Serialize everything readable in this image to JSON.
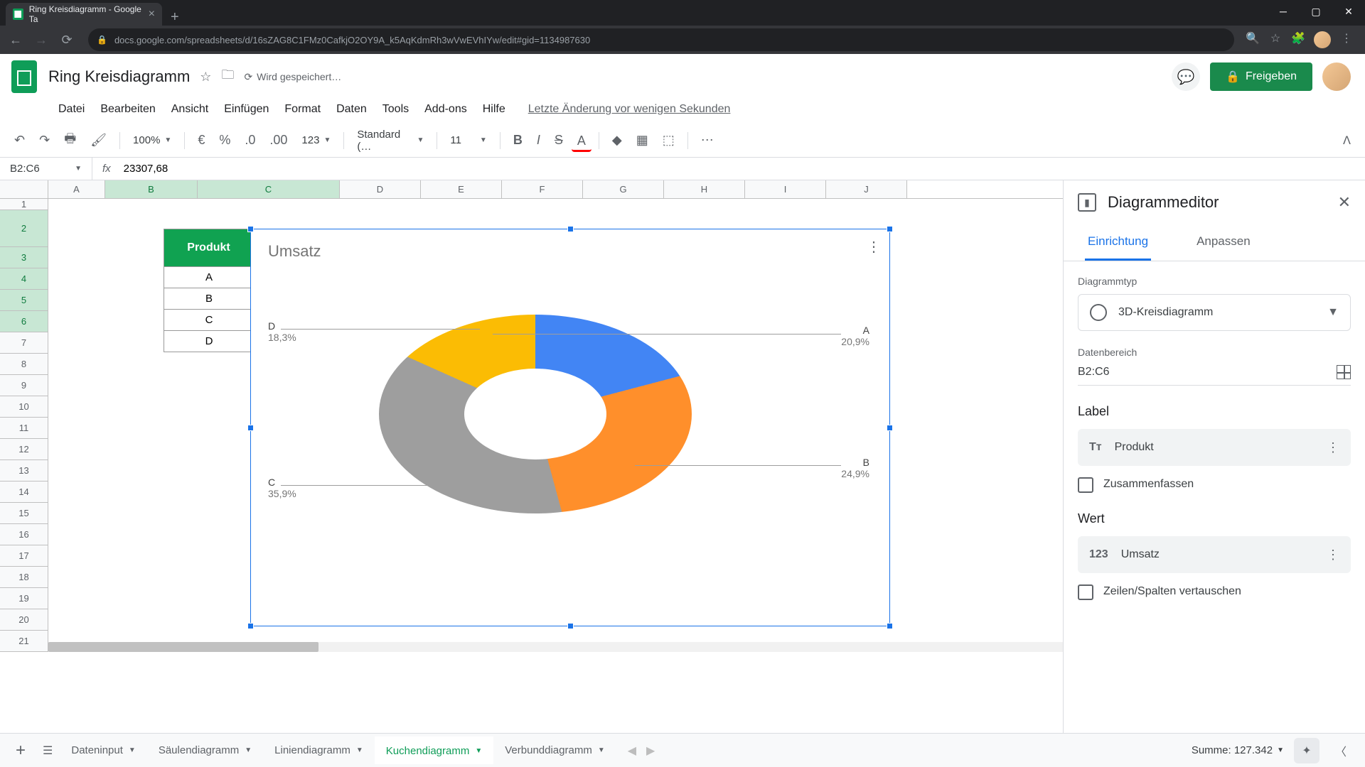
{
  "browser": {
    "tab_title": "Ring Kreisdiagramm - Google Ta",
    "url": "docs.google.com/spreadsheets/d/16sZAG8C1FMz0CafkjO2OY9A_k5AqKdmRh3wVwEVhIYw/edit#gid=1134987630"
  },
  "doc": {
    "title": "Ring Kreisdiagramm",
    "saving": "Wird gespeichert…",
    "last_edit": "Letzte Änderung vor wenigen Sekunden"
  },
  "menu": [
    "Datei",
    "Bearbeiten",
    "Ansicht",
    "Einfügen",
    "Format",
    "Daten",
    "Tools",
    "Add-ons",
    "Hilfe"
  ],
  "toolbar": {
    "zoom": "100%",
    "font": "Standard (…",
    "font_size": "11"
  },
  "share_label": "Freigeben",
  "formula_bar": {
    "cell_ref": "B2:C6",
    "value": "23307,68"
  },
  "columns": [
    "A",
    "B",
    "C",
    "D",
    "E",
    "F",
    "G",
    "H",
    "I",
    "J"
  ],
  "rows": [
    1,
    2,
    3,
    4,
    5,
    6,
    7,
    8,
    9,
    10,
    11,
    12,
    13,
    14,
    15,
    16,
    17,
    18,
    19,
    20,
    21
  ],
  "table": {
    "header": "Produkt",
    "rows": [
      "A",
      "B",
      "C",
      "D"
    ]
  },
  "chart": {
    "title": "Umsatz",
    "labels": {
      "A": {
        "name": "A",
        "pct": "20,9%"
      },
      "B": {
        "name": "B",
        "pct": "24,9%"
      },
      "C": {
        "name": "C",
        "pct": "35,9%"
      },
      "D": {
        "name": "D",
        "pct": "18,3%"
      }
    }
  },
  "chart_data": {
    "type": "pie",
    "title": "Umsatz",
    "categories": [
      "A",
      "B",
      "C",
      "D"
    ],
    "values": [
      20.9,
      24.9,
      35.9,
      18.3
    ],
    "colors": [
      "#4285f4",
      "#ff8f2b",
      "#9e9e9e",
      "#fbbc04"
    ],
    "style": "3d-donut"
  },
  "panel": {
    "title": "Diagrammeditor",
    "tabs": {
      "setup": "Einrichtung",
      "customize": "Anpassen"
    },
    "chart_type_label": "Diagrammtyp",
    "chart_type_value": "3D-Kreisdiagramm",
    "data_range_label": "Datenbereich",
    "data_range_value": "B2:C6",
    "label_section": "Label",
    "label_field": "Produkt",
    "aggregate": "Zusammenfassen",
    "value_section": "Wert",
    "value_field": "Umsatz",
    "switch_rows_cols": "Zeilen/Spalten vertauschen"
  },
  "sheets": {
    "tabs": [
      "Dateninput",
      "Säulendiagramm",
      "Liniendiagramm",
      "Kuchendiagramm",
      "Verbunddiagramm"
    ],
    "active": "Kuchendiagramm",
    "sum": "Summe: 127.342"
  }
}
